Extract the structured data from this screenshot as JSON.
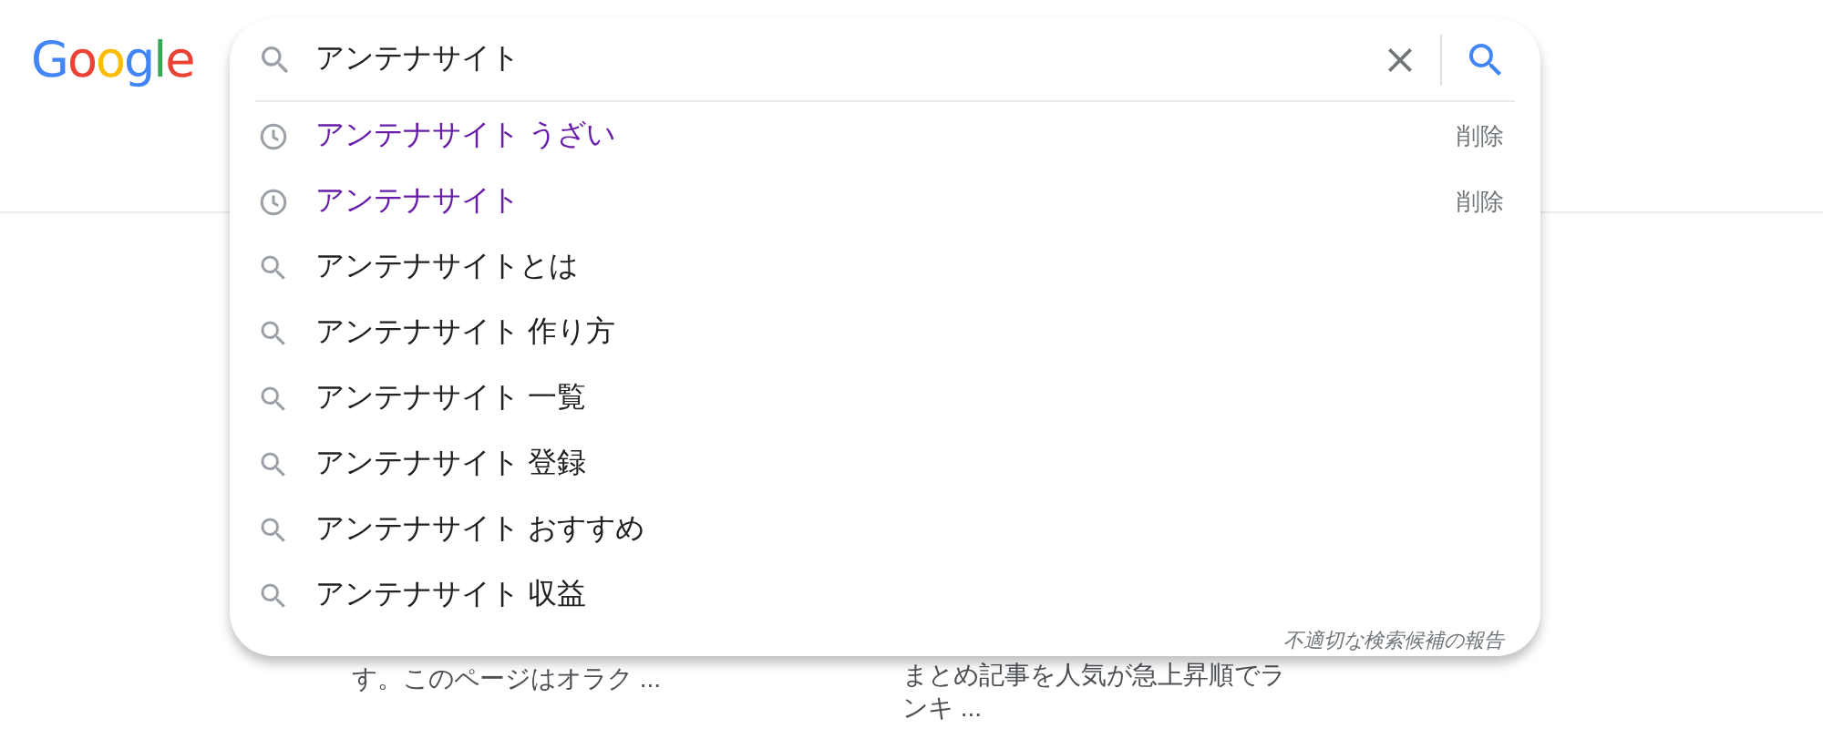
{
  "logo": {
    "letters": [
      {
        "char": "G",
        "color": "#4285f4"
      },
      {
        "char": "o",
        "color": "#ea4335"
      },
      {
        "char": "o",
        "color": "#fbbc05"
      },
      {
        "char": "g",
        "color": "#4285f4"
      },
      {
        "char": "l",
        "color": "#34a853"
      },
      {
        "char": "e",
        "color": "#ea4335"
      }
    ]
  },
  "search": {
    "value": "アンテナサイト"
  },
  "suggestions": [
    {
      "kind": "history",
      "text": "アンテナサイト うざい",
      "action": "削除"
    },
    {
      "kind": "history",
      "text": "アンテナサイト",
      "action": "削除"
    },
    {
      "kind": "suggestion",
      "text": "アンテナサイトとは"
    },
    {
      "kind": "suggestion",
      "text": "アンテナサイト 作り方"
    },
    {
      "kind": "suggestion",
      "text": "アンテナサイト 一覧"
    },
    {
      "kind": "suggestion",
      "text": "アンテナサイト 登録"
    },
    {
      "kind": "suggestion",
      "text": "アンテナサイト おすすめ"
    },
    {
      "kind": "suggestion",
      "text": "アンテナサイト 収益"
    }
  ],
  "report_link": "不適切な検索候補の報告",
  "results": [
    {
      "lines": [
        "す。このページはオラク ..."
      ]
    },
    {
      "lines": [
        "まとめ記事を人気が急上昇順でラ",
        "ンキ ..."
      ]
    }
  ]
}
